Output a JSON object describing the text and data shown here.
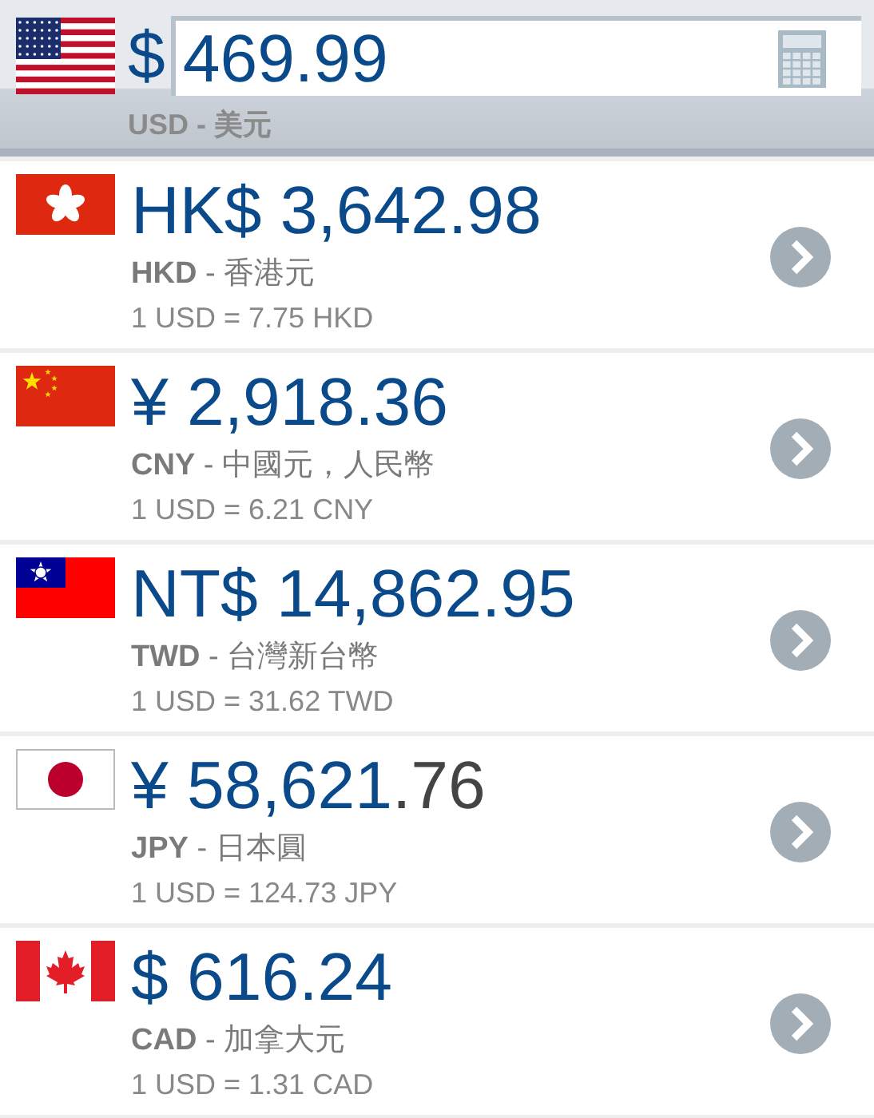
{
  "base": {
    "kind": "us",
    "symbol": "$",
    "value": "469.99",
    "caption": "USD - 美元"
  },
  "rows": [
    {
      "kind": "hk",
      "amount": "HK$ 3,642.98",
      "label": "**HKD** - 香港元",
      "rate": "1 USD = 7.75 HKD"
    },
    {
      "kind": "cn",
      "amount": "¥ 2,918.36",
      "label": "**CNY** - 中國元，人民幣",
      "rate": "1 USD = 6.21 CNY"
    },
    {
      "kind": "tw",
      "amount": "NT$ 14,862.95",
      "label": "**TWD** - 台灣新台幣",
      "rate": "1 USD = 31.62 TWD"
    },
    {
      "kind": "jp",
      "amount": "¥ 58,621",
      "dimmed_part": ".76",
      "label": "**JPY** - 日本圓",
      "rate": "1 USD = 124.73 JPY"
    },
    {
      "kind": "ca",
      "amount": "$ 616.24",
      "label": "**CAD** - 加拿大元",
      "rate": "1 USD = 1.31 CAD"
    }
  ]
}
